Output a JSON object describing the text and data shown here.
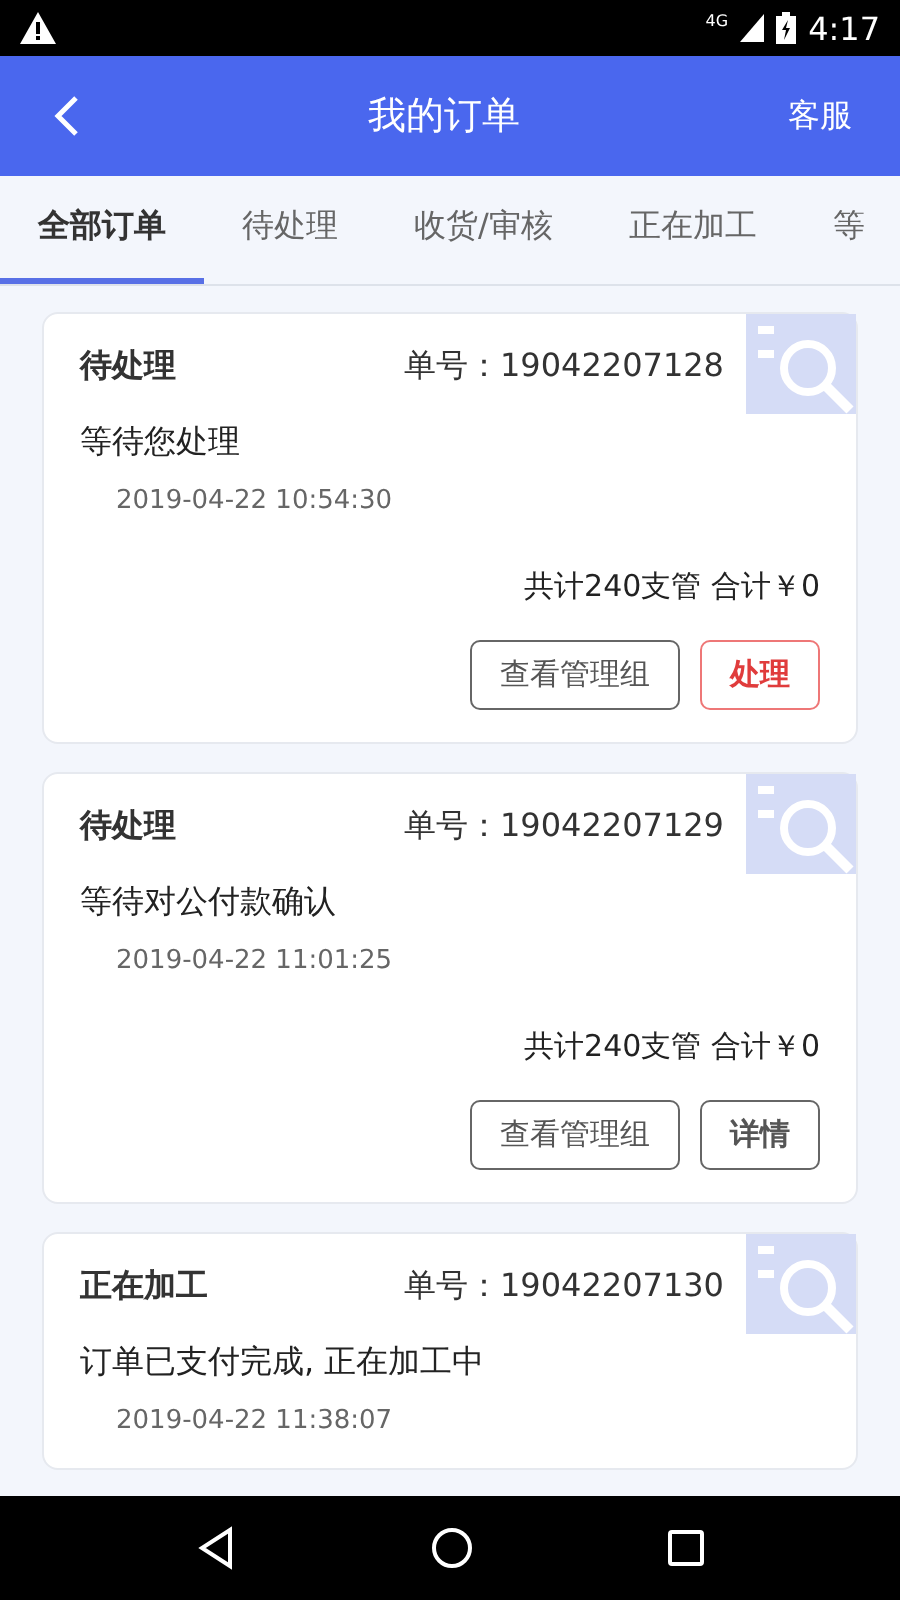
{
  "status_bar": {
    "time": "4:17",
    "network": "4G"
  },
  "header": {
    "title": "我的订单",
    "action": "客服"
  },
  "tabs": [
    {
      "label": "全部订单",
      "selected": true
    },
    {
      "label": "待处理",
      "selected": false
    },
    {
      "label": "收货/审核",
      "selected": false
    },
    {
      "label": "正在加工",
      "selected": false
    },
    {
      "label": "等",
      "selected": false
    }
  ],
  "orders": [
    {
      "status": "待处理",
      "number": "单号：19042207128",
      "message": "等待您处理",
      "time": "2019-04-22 10:54:30",
      "summary": "共计240支管 合计￥0",
      "buttons": [
        {
          "label": "查看管理组",
          "kind": "default"
        },
        {
          "label": "处理",
          "kind": "accent"
        }
      ]
    },
    {
      "status": "待处理",
      "number": "单号：19042207129",
      "message": "等待对公付款确认",
      "time": "2019-04-22 11:01:25",
      "summary": "共计240支管 合计￥0",
      "buttons": [
        {
          "label": "查看管理组",
          "kind": "default"
        },
        {
          "label": "详情",
          "kind": "strong"
        }
      ]
    },
    {
      "status": "正在加工",
      "number": "单号：19042207130",
      "message": "订单已支付完成, 正在加工中",
      "time": "2019-04-22 11:38:07"
    }
  ]
}
